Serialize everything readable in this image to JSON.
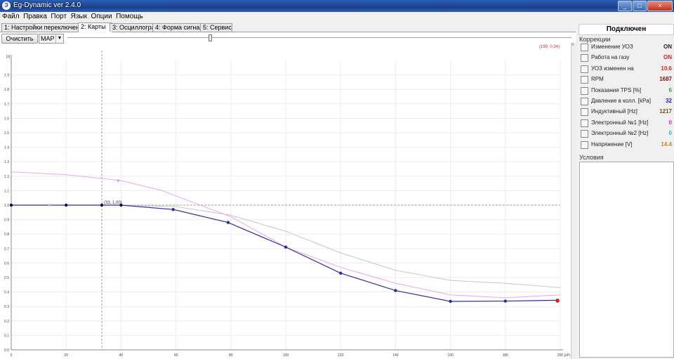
{
  "window": {
    "title": "Eg-Dynamic ver 2.4.0",
    "icon": "app-icon",
    "min": "_",
    "max": "□",
    "close": "×"
  },
  "menu": [
    "Файл",
    "Правка",
    "Порт",
    "Язык",
    "Опции",
    "Помощь"
  ],
  "tabs": [
    "1: Настройки переключения",
    "2: Карты",
    "3: Осциллограф",
    "4: Форма сигнала",
    "5: Сервис"
  ],
  "active_tab": 1,
  "toolbar": {
    "clear_label": "Очистить",
    "map_select": "MAP",
    "slider_value_fraction": 0.28
  },
  "coord_readout": "(199, 0.34)",
  "cursor_label": "(33, 1.00)",
  "chart_data": {
    "type": "line",
    "x_unit": "[кPa]",
    "y_unit": "[x]",
    "xlim": [
      0,
      200
    ],
    "ylim": [
      0,
      2.0
    ],
    "x_ticks": [
      0,
      20,
      40,
      60,
      80,
      100,
      120,
      140,
      160,
      180,
      200
    ],
    "y_ticks": [
      "0.0",
      "0.1",
      "0.2",
      "0.3",
      "0.4",
      "0.5",
      "0.6",
      "0.7",
      "0.8",
      "0.9",
      "1.0",
      "1.1",
      "1.2",
      "1.3",
      "1.4",
      "1.5",
      "1.6",
      "1.7",
      "1.8",
      "1.9"
    ],
    "grid": true,
    "reference_y": 1.0,
    "cursor_x": 33,
    "series": [
      {
        "color": "#2c2ca8",
        "x": [
          0,
          20,
          33,
          40,
          59,
          79,
          100,
          120,
          140,
          160,
          180,
          199
        ],
        "y": [
          1.0,
          1.0,
          1.0,
          1.0,
          0.97,
          0.88,
          0.71,
          0.53,
          0.41,
          0.335,
          0.337,
          0.343
        ]
      },
      {
        "color": "#e9a9e9",
        "x": [
          0,
          20,
          40,
          55,
          80,
          100,
          120,
          140,
          160,
          180,
          200
        ],
        "y": [
          1.23,
          1.21,
          1.17,
          1.1,
          0.92,
          0.71,
          0.57,
          0.46,
          0.38,
          0.36,
          0.38
        ]
      },
      {
        "color": "#c6c6c6",
        "x": [
          0,
          20,
          40,
          60,
          80,
          100,
          120,
          140,
          160,
          180,
          200
        ],
        "y": [
          1.0,
          1.0,
          1.0,
          0.99,
          0.93,
          0.82,
          0.67,
          0.55,
          0.48,
          0.46,
          0.43
        ]
      }
    ],
    "ghost_points": [
      {
        "x": 14,
        "y": 1.0
      },
      {
        "x": 39,
        "y": 1.17
      }
    ],
    "highlight_point": {
      "x": 199,
      "y": 0.34,
      "color": "#e02020"
    }
  },
  "right_panel": {
    "status": "Подключен",
    "corrections_label": "Коррекции",
    "rows": [
      {
        "label": "Изменение УОЗ",
        "value": "ON",
        "color": "#222222"
      },
      {
        "label": "Работа на газу",
        "value": "ON",
        "color": "#e02020"
      },
      {
        "label": "УОЗ изменен на",
        "value": "10.6",
        "color": "#e02020"
      },
      {
        "label": "RPM",
        "value": "1687",
        "color": "#7a1010"
      },
      {
        "label": "Показания TPS [%]",
        "value": "6",
        "color": "#20b020"
      },
      {
        "label": "Давление в колл. [kPa]",
        "value": "32",
        "color": "#2020c0"
      },
      {
        "label": "Индуктивный [Hz]",
        "value": "1217",
        "color": "#7a4a10"
      },
      {
        "label": "Электронный №1 [Hz]",
        "value": "0",
        "color": "#e020e0"
      },
      {
        "label": "Электронный №2 [Hz]",
        "value": "0",
        "color": "#20c0d0"
      },
      {
        "label": "Напряжение [V]",
        "value": "14.4",
        "color": "#c08a10"
      }
    ],
    "conditions_label": "Условия"
  }
}
